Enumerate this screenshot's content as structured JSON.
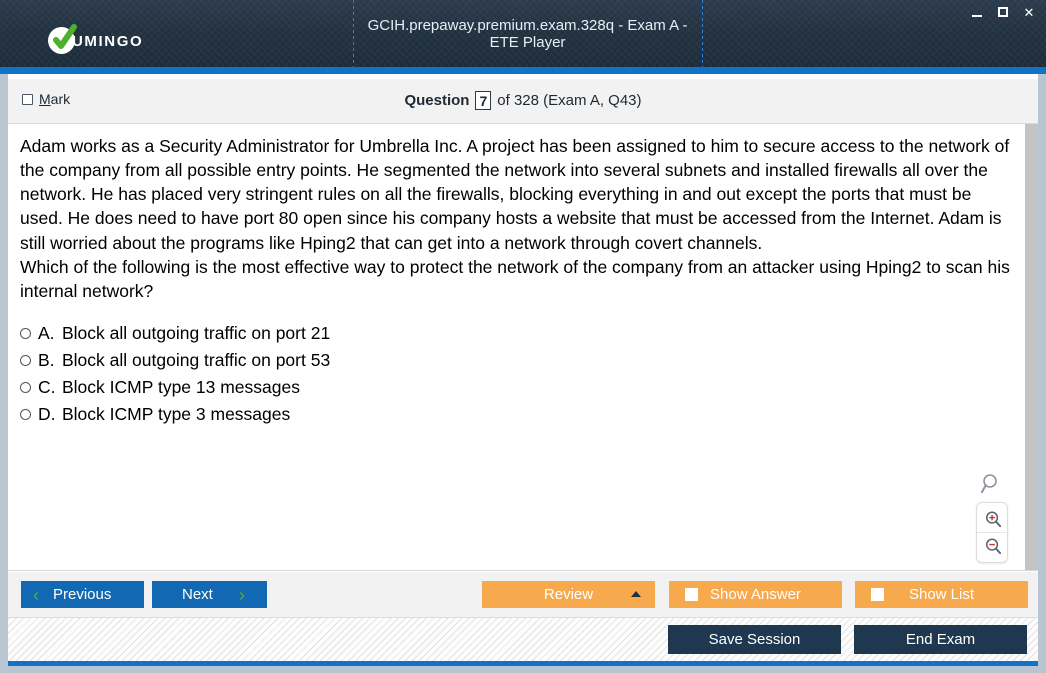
{
  "window": {
    "title": "GCIH.prepaway.premium.exam.328q - Exam A - ETE Player",
    "logo_text": "UMINGO",
    "controls": {
      "minimize": "minimize",
      "maximize": "maximize",
      "close": "✕"
    },
    "accent_blue": "#1273c4",
    "titlebar_dark": "#22313f"
  },
  "question_bar": {
    "mark_label_accel": "M",
    "mark_label_rest": "ark",
    "question_word": "Question",
    "question_number": "7",
    "of_text": "of 328 (Exam A, Q43)"
  },
  "question": {
    "text": "Adam works as a Security Administrator for Umbrella Inc. A project has been assigned to him to secure access to the network of the company from all possible entry points. He segmented the network into several subnets and installed firewalls all over the network. He has placed very stringent rules on all the firewalls, blocking everything in and out except the ports that must be used. He does need to have port 80 open since his company hosts a website that must be accessed from the Internet. Adam is still worried about the programs like Hping2 that can get into a network through covert channels.\nWhich of the following is the most effective way to protect the network of the company from an attacker using Hping2 to scan his internal network?",
    "options": [
      {
        "letter": "A.",
        "text": "Block all outgoing traffic on port 21",
        "selected": false
      },
      {
        "letter": "B.",
        "text": "Block all outgoing traffic on port 53",
        "selected": false
      },
      {
        "letter": "C.",
        "text": "Block ICMP type 13 messages",
        "selected": false
      },
      {
        "letter": "D.",
        "text": "Block ICMP type 3 messages",
        "selected": false
      }
    ]
  },
  "zoom_tools": {
    "loupe_icon": "magnifier-icon",
    "zoom_in_icon": "zoom-in-icon",
    "zoom_out_icon": "zoom-out-icon"
  },
  "toolbar": {
    "previous_label": "Previous",
    "next_label": "Next",
    "review_label": "Review",
    "show_answer_label": "Show Answer",
    "show_list_label": "Show List",
    "prev_chevron": "‹",
    "next_chevron": "›",
    "button_blue": "#1268b3",
    "button_orange": "#f7a94e",
    "chevron_green": "#5aab3c"
  },
  "footer": {
    "save_session_label": "Save Session",
    "end_exam_label": "End Exam",
    "button_dark": "#1f3850"
  }
}
